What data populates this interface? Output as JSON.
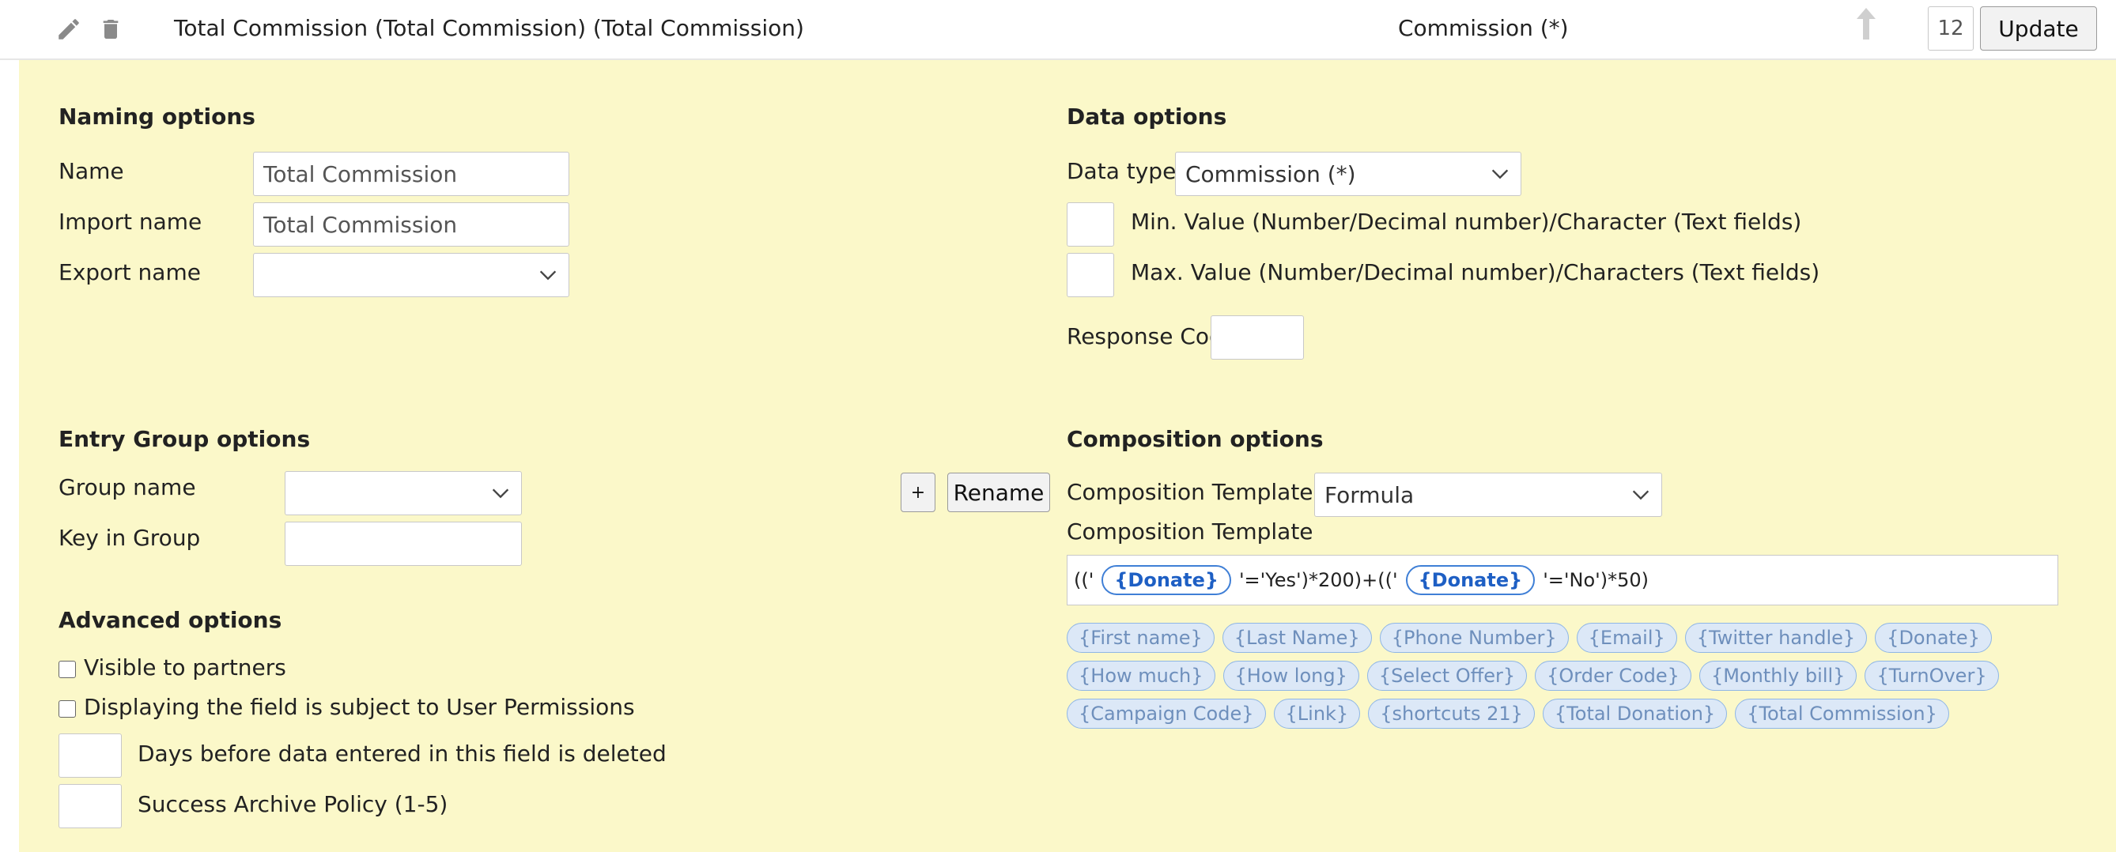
{
  "header": {
    "title": "Total Commission (Total Commission) (Total Commission)",
    "type_label": "Commission (*)",
    "order_value": "12",
    "update_label": "Update"
  },
  "naming": {
    "heading": "Naming options",
    "name_label": "Name",
    "name_value": "Total Commission",
    "import_label": "Import name",
    "import_value": "Total Commission",
    "export_label": "Export name",
    "export_value": ""
  },
  "data_options": {
    "heading": "Data options",
    "type_label": "Data type",
    "type_value": "Commission (*)",
    "min_label": "Min. Value (Number/Decimal number)/Character (Text fields)",
    "max_label": "Max. Value (Number/Decimal number)/Characters (Text fields)",
    "response_label": "Response Code"
  },
  "entry_group": {
    "heading": "Entry Group options",
    "group_label": "Group name",
    "group_value": "",
    "key_label": "Key in Group",
    "add_label": "+",
    "rename_label": "Rename"
  },
  "advanced": {
    "heading": "Advanced options",
    "visible_label": "Visible to partners",
    "permissions_label": "Displaying the field is subject to User Permissions",
    "days_label": "Days before data entered in this field is deleted",
    "archive_label": "Success Archive Policy (1-5)"
  },
  "composition": {
    "heading": "Composition options",
    "template_type_label": "Composition Template type",
    "template_type_value": "Formula",
    "template_label": "Composition Template",
    "formula_parts": [
      "(('",
      "{Donate}",
      "'='Yes')*200)+(('",
      "{Donate}",
      "'='No')*50)"
    ],
    "chips": [
      "{First name}",
      "{Last Name}",
      "{Phone Number}",
      "{Email}",
      "{Twitter handle}",
      "{Donate}",
      "{How much}",
      "{How long}",
      "{Select Offer}",
      "{Order Code}",
      "{Monthly bill}",
      "{TurnOver}",
      "{Campaign Code}",
      "{Link}",
      "{shortcuts 21}",
      "{Total Donation}",
      "{Total Commission}"
    ]
  },
  "icons": {
    "edit": "pencil-icon",
    "delete": "trash-icon",
    "move_up": "arrow-up-icon",
    "dropdown": "chevron-down-icon"
  },
  "colors": {
    "panel_bg": "#fbf8c9",
    "chip_bg": "#dce8f7",
    "chip_border": "#8fb6e6",
    "accent": "#3f7fd6"
  }
}
